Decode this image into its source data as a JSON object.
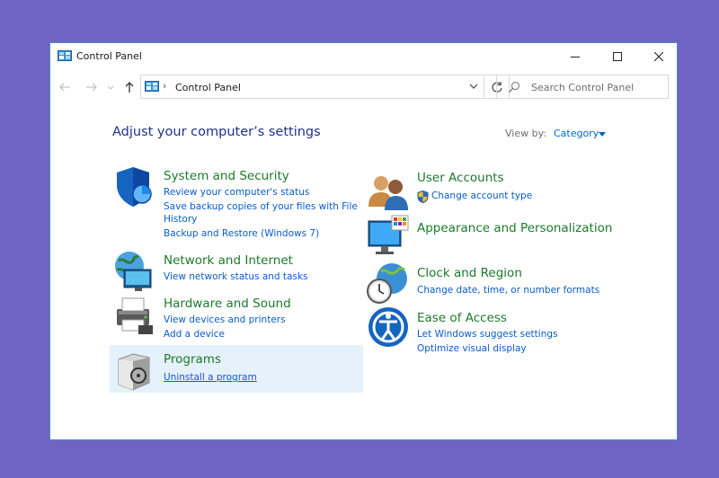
{
  "window": {
    "title": "Control Panel",
    "buttons": {
      "minimize": "—",
      "maximize": "□",
      "close": "✕"
    }
  },
  "nav": {
    "address_sep": "›",
    "address_text": "Control Panel",
    "search_placeholder": "Search Control Panel"
  },
  "main": {
    "heading": "Adjust your computer’s settings",
    "view_by_label": "View by:",
    "view_by_value": "Category"
  },
  "categories": {
    "system_security": {
      "title": "System and Security",
      "links": [
        "Review your computer's status",
        "Save backup copies of your files with File",
        "History",
        "Backup and Restore (Windows 7)"
      ]
    },
    "network": {
      "title": "Network and Internet",
      "links": [
        "View network status and tasks"
      ]
    },
    "hardware": {
      "title": "Hardware and Sound",
      "links": [
        "View devices and printers",
        "Add a device"
      ]
    },
    "programs": {
      "title": "Programs",
      "links": [
        "Uninstall a program"
      ]
    },
    "user_accounts": {
      "title": "User Accounts",
      "links": [
        "Change account type"
      ]
    },
    "appearance": {
      "title": "Appearance and Personalization",
      "links": []
    },
    "clock": {
      "title": "Clock and Region",
      "links": [
        "Change date, time, or number formats"
      ]
    },
    "ease": {
      "title": "Ease of Access",
      "links": [
        "Let Windows suggest settings",
        "Optimize visual display"
      ]
    }
  },
  "colors": {
    "background": "#6f64c3",
    "heading": "#1e3287",
    "category_title": "#1b7a2b",
    "link": "#0a5cc9",
    "highlight": "#e5f1fb"
  }
}
